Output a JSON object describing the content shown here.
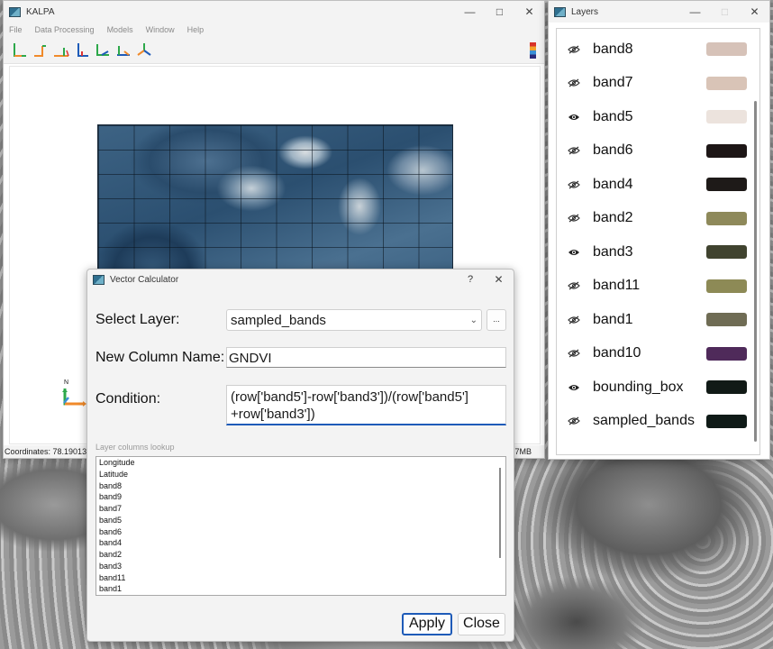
{
  "kalpa": {
    "title": "KALPA",
    "menu": [
      "File",
      "Data Processing",
      "Models",
      "Window",
      "Help"
    ],
    "status_coordinates": "Coordinates: 78.19013, 3",
    "status_memory": "7MB",
    "north_label": "N"
  },
  "layers_window": {
    "title": "Layers",
    "items": [
      {
        "name": "band8",
        "visible": false,
        "color": "#d6c2b8"
      },
      {
        "name": "band7",
        "visible": false,
        "color": "#d9c4b7"
      },
      {
        "name": "band5",
        "visible": true,
        "color": "#ece3dd"
      },
      {
        "name": "band6",
        "visible": false,
        "color": "#1d1616"
      },
      {
        "name": "band4",
        "visible": false,
        "color": "#1e1a18"
      },
      {
        "name": "band2",
        "visible": false,
        "color": "#8e895a"
      },
      {
        "name": "band3",
        "visible": true,
        "color": "#40432f"
      },
      {
        "name": "band11",
        "visible": false,
        "color": "#8d8a56"
      },
      {
        "name": "band1",
        "visible": false,
        "color": "#6f6c54"
      },
      {
        "name": "band10",
        "visible": false,
        "color": "#4f2a5a"
      },
      {
        "name": "bounding_box",
        "visible": true,
        "color": "#111a16"
      },
      {
        "name": "sampled_bands",
        "visible": false,
        "color": "#0f1a17"
      }
    ]
  },
  "vector_calculator": {
    "title": "Vector Calculator",
    "help": "?",
    "select_layer_label": "Select Layer:",
    "select_layer_value": "sampled_bands",
    "new_column_label": "New Column Name:",
    "new_column_value": "GNDVI",
    "condition_label": "Condition:",
    "condition_value": "(row['band5']-row['band3'])/(row['band5']\n+row['band3'])",
    "lookup_label": "Layer columns lookup",
    "columns": [
      "Longitude",
      "Latitude",
      "band8",
      "band9",
      "band7",
      "band5",
      "band6",
      "band4",
      "band2",
      "band3",
      "band11",
      "band1"
    ],
    "apply_label": "Apply",
    "close_label": "Close",
    "browse_label": "..."
  }
}
